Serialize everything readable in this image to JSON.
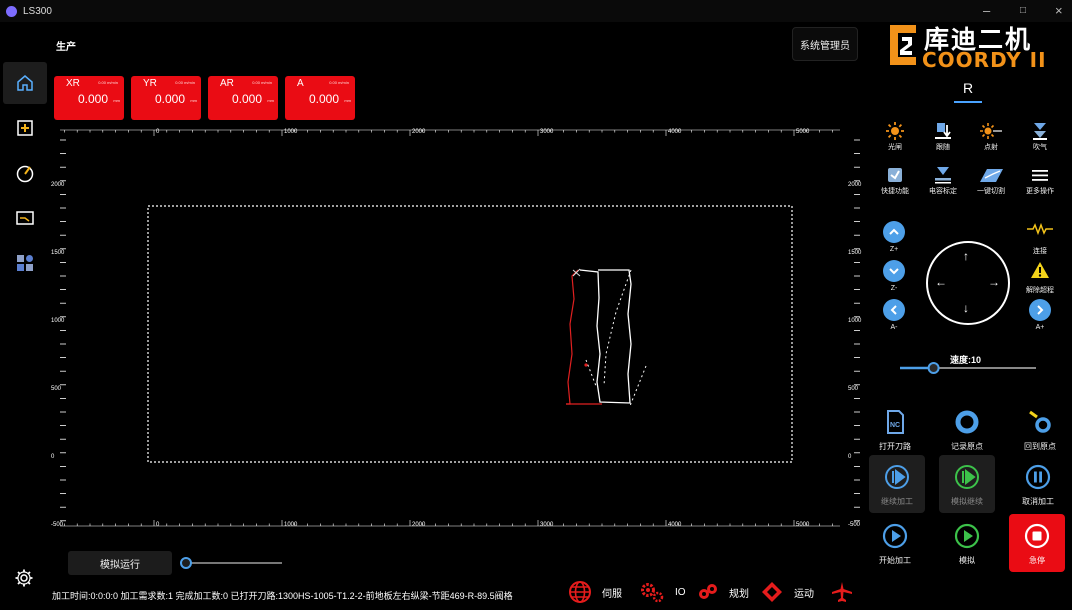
{
  "window": {
    "title": "LS300"
  },
  "page_title": "生产",
  "user_button": "系统管理员",
  "logo": {
    "cn": "库迪二机",
    "en": "COORDY II"
  },
  "sidebar": [
    {
      "icon": "home-icon"
    },
    {
      "icon": "crosshair-panel-icon"
    },
    {
      "icon": "compass-icon"
    },
    {
      "icon": "monitor-icon"
    },
    {
      "icon": "apps-icon"
    }
  ],
  "axis_cards": [
    {
      "name": "XR",
      "rate": "0.00 m/min",
      "value": "0.000",
      "unit": "mm"
    },
    {
      "name": "YR",
      "rate": "0.00 m/min",
      "value": "0.000",
      "unit": "mm"
    },
    {
      "name": "AR",
      "rate": "0.00 m/min",
      "value": "0.000",
      "unit": "mm"
    },
    {
      "name": "A",
      "rate": "0.00 m/min",
      "value": "0.000",
      "unit": "mm"
    }
  ],
  "ruler": {
    "top": [
      "0",
      "1000",
      "2000",
      "3000",
      "4000",
      "5000"
    ],
    "side": [
      "2000",
      "1500",
      "1000",
      "500",
      "0",
      "-500"
    ]
  },
  "sim_button": "模拟运行",
  "sim_speed": 0.0,
  "status": {
    "text": "加工时间:0:0:0:0  加工需求数:1  完成加工数:0  已打开刀路:1300HS-1005-T1.2-2-前地板左右纵梁-节距469-R-89.5阀格",
    "servo": "伺服",
    "io": "IO",
    "plan": "规划",
    "motion": "运动"
  },
  "r_tab": "R",
  "tools": [
    {
      "label": "光闸",
      "icon": "sun-icon"
    },
    {
      "label": "跟随",
      "icon": "follow-icon"
    },
    {
      "label": "点射",
      "icon": "spot-shot-icon"
    },
    {
      "label": "吹气",
      "icon": "blow-icon"
    },
    {
      "label": "快捷功能",
      "icon": "quick-function-icon"
    },
    {
      "label": "电容标定",
      "icon": "capacitance-calibration-icon"
    },
    {
      "label": "一键切割",
      "icon": "one-key-cut-icon"
    },
    {
      "label": "更多操作",
      "icon": "more-icon"
    }
  ],
  "jog": {
    "z_plus": "Z+",
    "z_minus": "Z-",
    "a_minus": "A-",
    "a_plus": "A+",
    "connect": "连接",
    "release_limit": "解除超程"
  },
  "speed": {
    "label": "速度:10",
    "value": 10,
    "max": 100
  },
  "actions": [
    {
      "label": "打开刀路",
      "icon": "nc-file-icon"
    },
    {
      "label": "记录原点",
      "icon": "record-origin-icon"
    },
    {
      "label": "回到原点",
      "icon": "return-origin-icon"
    },
    {
      "label": "继续加工",
      "icon": "resume-icon"
    },
    {
      "label": "模拟继续",
      "icon": "sim-resume-icon"
    },
    {
      "label": "取消加工",
      "icon": "pause-icon"
    },
    {
      "label": "开始加工",
      "icon": "start-icon"
    },
    {
      "label": "模拟",
      "icon": "simulate-icon"
    },
    {
      "label": "急停",
      "icon": "emergency-stop-icon"
    }
  ],
  "colors": {
    "accent_red": "#ea0c14",
    "accent_blue": "#4d9fe8",
    "logo_orange": "#f29219"
  }
}
